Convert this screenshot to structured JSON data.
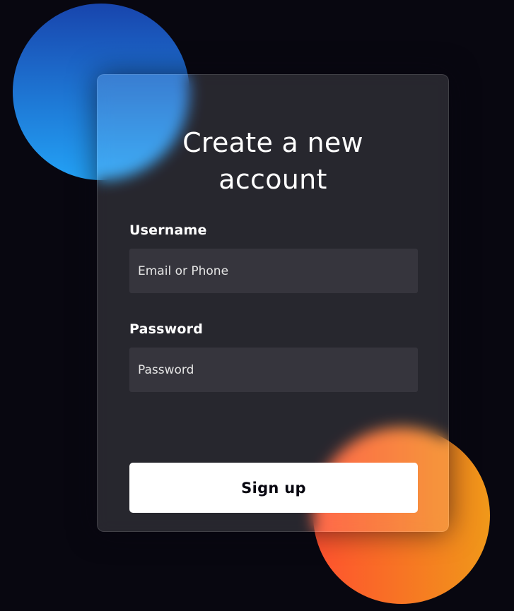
{
  "form": {
    "title_line1": "Create a new",
    "title_line2": "account",
    "username": {
      "label": "Username",
      "placeholder": "Email or Phone",
      "value": ""
    },
    "password": {
      "label": "Password",
      "placeholder": "Password",
      "value": ""
    },
    "submit_label": "Sign up"
  },
  "colors": {
    "background": "#080710",
    "blue_circle_top": "#1845ad",
    "blue_circle_bottom": "#23a2f6",
    "orange_circle_left": "#ff512f",
    "orange_circle_right": "#f09819",
    "button_bg": "#ffffff"
  }
}
